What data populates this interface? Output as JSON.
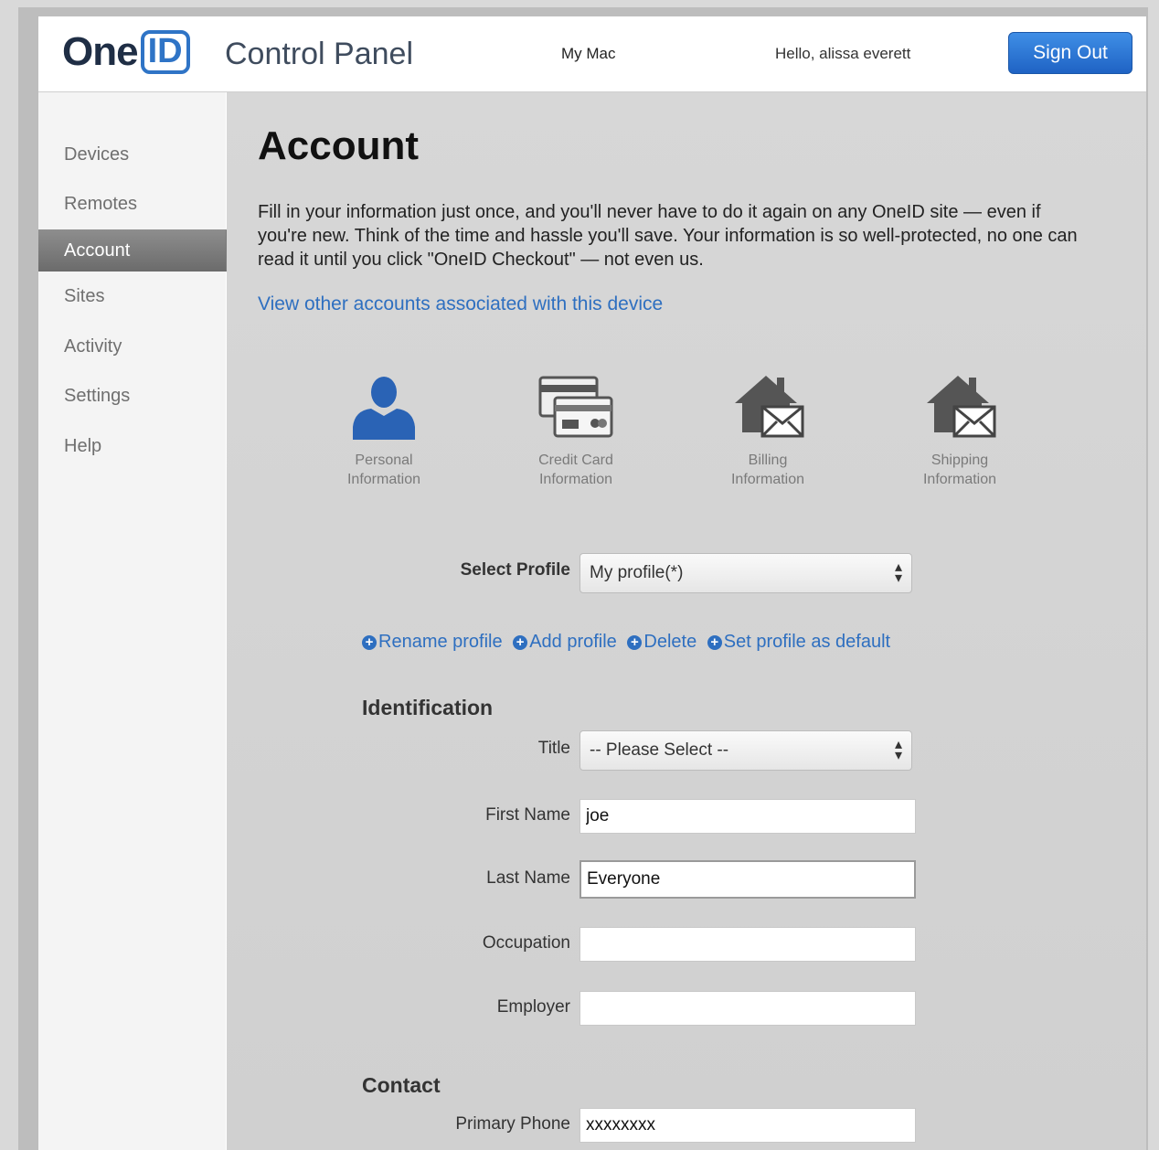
{
  "header": {
    "logo_text_one": "One",
    "logo_text_id": "ID",
    "app_title": "Control Panel",
    "device_name": "My Mac",
    "greeting": "Hello, alissa everett",
    "sign_out_label": "Sign Out",
    "accent_color": "#2f74c6"
  },
  "sidebar": {
    "items": [
      {
        "label": "Devices"
      },
      {
        "label": "Remotes"
      },
      {
        "label": "Account",
        "active": true
      },
      {
        "label": "Sites"
      },
      {
        "label": "Activity"
      },
      {
        "label": "Settings"
      },
      {
        "label": "Help"
      }
    ]
  },
  "main": {
    "title": "Account",
    "intro": "Fill in your information just once, and you'll never have to do it again on any OneID site — even if you're new. Think of the time and hassle you'll save. Your information is so well-protected, no one can read it until you click \"OneID Checkout\" — not even us.",
    "other_accounts_link": "View other accounts associated with this device",
    "categories": [
      {
        "icon": "person-icon",
        "line1": "Personal",
        "line2": "Information"
      },
      {
        "icon": "credit-card-icon",
        "line1": "Credit Card",
        "line2": "Information"
      },
      {
        "icon": "house-mail-icon",
        "line1": "Billing",
        "line2": "Information"
      },
      {
        "icon": "house-mail-icon",
        "line1": "Shipping",
        "line2": "Information"
      }
    ],
    "select_profile_label": "Select Profile",
    "select_profile_value": "My profile(*)",
    "profile_actions": [
      "Rename profile",
      "Add profile",
      "Delete",
      "Set profile as default"
    ],
    "identification_heading": "Identification",
    "title_label": "Title",
    "title_value": "-- Please Select --",
    "first_name_label": "First Name",
    "first_name_value": "joe",
    "last_name_label": "Last Name",
    "last_name_value": "Everyone",
    "occupation_label": "Occupation",
    "occupation_value": "",
    "employer_label": "Employer",
    "employer_value": "",
    "contact_heading": "Contact",
    "primary_phone_label": "Primary Phone",
    "primary_phone_value": "xxxxxxxx"
  }
}
